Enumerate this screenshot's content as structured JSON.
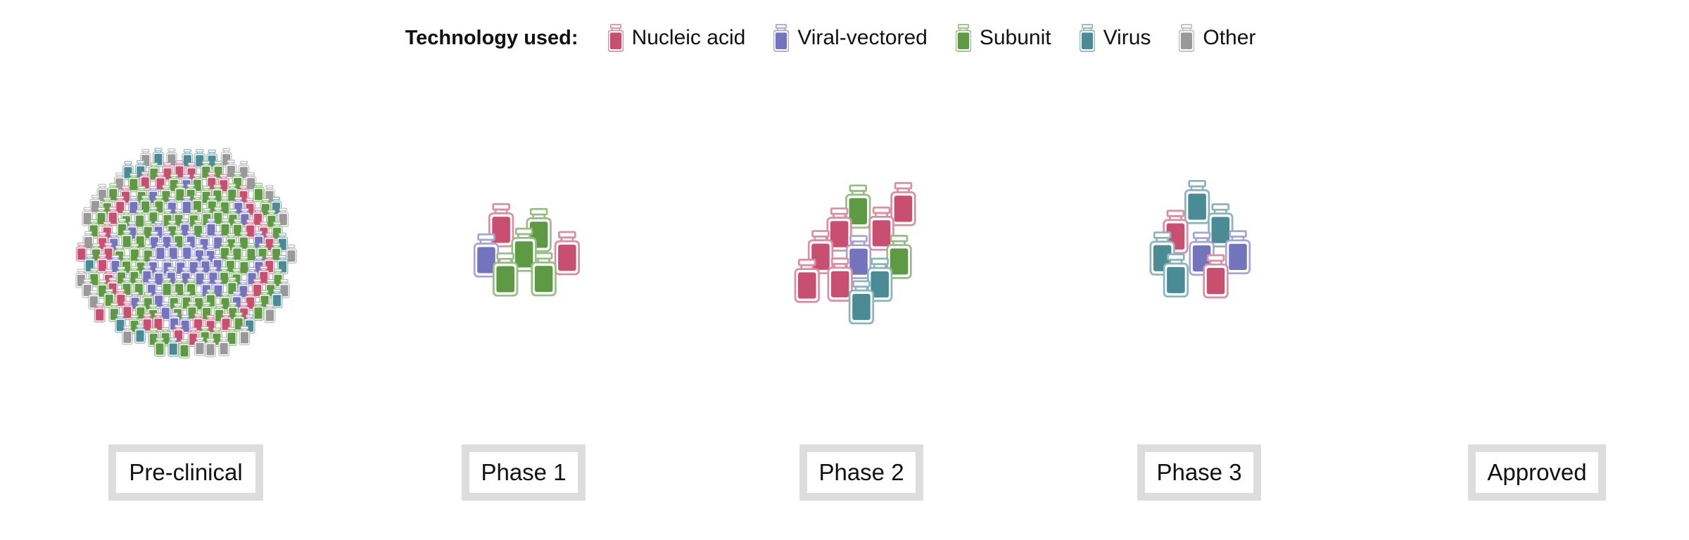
{
  "chart_data": {
    "type": "scatter",
    "legend": {
      "title": "Technology used:",
      "entries": [
        {
          "key": "nucleic",
          "label": "Nucleic acid",
          "color": "#c94f70"
        },
        {
          "key": "viral",
          "label": "Viral-vectored",
          "color": "#7474be"
        },
        {
          "key": "subunit",
          "label": "Subunit",
          "color": "#5e9a44"
        },
        {
          "key": "virus",
          "label": "Virus",
          "color": "#4b8b96"
        },
        {
          "key": "other",
          "label": "Other",
          "color": "#999999"
        }
      ]
    },
    "stages": [
      {
        "label": "Pre-clinical",
        "counts": {
          "nucleic": 38,
          "viral": 48,
          "subunit": 100,
          "virus": 15,
          "other": 24
        }
      },
      {
        "label": "Phase 1",
        "counts": {
          "nucleic": 2,
          "viral": 1,
          "subunit": 4,
          "virus": 0,
          "other": 0
        }
      },
      {
        "label": "Phase 2",
        "counts": {
          "nucleic": 6,
          "viral": 1,
          "subunit": 2,
          "virus": 2,
          "other": 0
        }
      },
      {
        "label": "Phase 3",
        "counts": {
          "nucleic": 2,
          "viral": 2,
          "subunit": 0,
          "virus": 4,
          "other": 0
        }
      },
      {
        "label": "Approved",
        "counts": {
          "nucleic": 0,
          "viral": 0,
          "subunit": 0,
          "virus": 0,
          "other": 0
        }
      }
    ]
  }
}
